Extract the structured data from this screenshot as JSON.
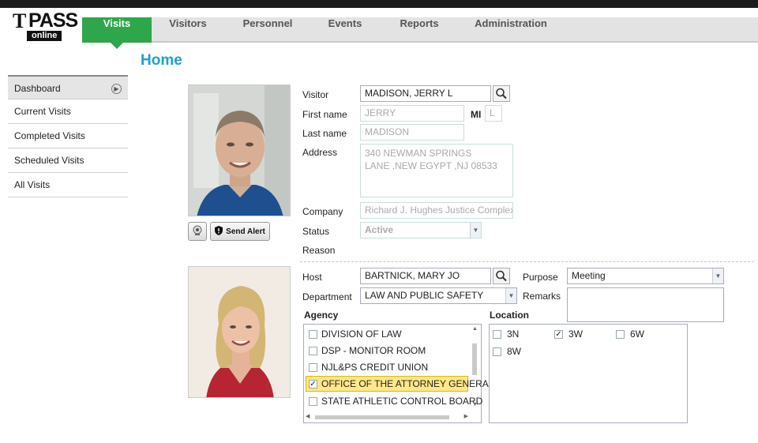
{
  "app": {
    "logo_main": "PASS",
    "logo_letter": "T",
    "logo_sub": "online"
  },
  "nav": {
    "tabs": [
      {
        "label": "Visits",
        "active": true
      },
      {
        "label": "Visitors",
        "active": false
      },
      {
        "label": "Personnel",
        "active": false
      },
      {
        "label": "Events",
        "active": false
      },
      {
        "label": "Reports",
        "active": false
      },
      {
        "label": "Administration",
        "active": false
      }
    ]
  },
  "page": {
    "title": "Home"
  },
  "sidebar": {
    "items": [
      {
        "label": "Dashboard",
        "active": true
      },
      {
        "label": "Current Visits",
        "active": false
      },
      {
        "label": "Completed Visits",
        "active": false
      },
      {
        "label": "Scheduled Visits",
        "active": false
      },
      {
        "label": "All Visits",
        "active": false
      }
    ]
  },
  "visitor": {
    "photo_icon": "visitor-photo",
    "alert_label": "Send Alert",
    "labels": {
      "visitor": "Visitor",
      "first_name": "First name",
      "mi": "MI",
      "last_name": "Last name",
      "address": "Address",
      "company": "Company",
      "status": "Status",
      "reason": "Reason"
    },
    "visitor_value": "MADISON, JERRY L",
    "first_name_value": "JERRY",
    "mi_value": "L",
    "last_name_value": "MADISON",
    "address_line1": "340 NEWMAN SPRINGS",
    "address_line2": "LANE ,NEW EGYPT ,NJ 08533",
    "company_value": "Richard J. Hughes Justice Complex",
    "status_value": "Active"
  },
  "host": {
    "labels": {
      "host": "Host",
      "department": "Department",
      "purpose": "Purpose",
      "remarks": "Remarks",
      "agency": "Agency",
      "location": "Location"
    },
    "host_value": "BARTNICK, MARY JO",
    "department_value": "LAW AND PUBLIC SAFETY",
    "purpose_value": "Meeting",
    "remarks_value": "",
    "agency_options": [
      {
        "label": "DIVISION OF LAW",
        "checked": false
      },
      {
        "label": "DSP - MONITOR ROOM",
        "checked": false
      },
      {
        "label": "NJL&PS CREDIT UNION",
        "checked": false
      },
      {
        "label": "OFFICE OF THE ATTORNEY GENERA",
        "checked": true
      },
      {
        "label": "STATE ATHLETIC CONTROL BOARD",
        "checked": false
      }
    ],
    "location_options": [
      {
        "label": "3N",
        "checked": false
      },
      {
        "label": "3W",
        "checked": true
      },
      {
        "label": "6W",
        "checked": false
      },
      {
        "label": "8W",
        "checked": false
      }
    ]
  },
  "colors": {
    "accent_green": "#2ea64a",
    "title_blue": "#1e9fd4",
    "selected_row": "#ffe78a"
  }
}
